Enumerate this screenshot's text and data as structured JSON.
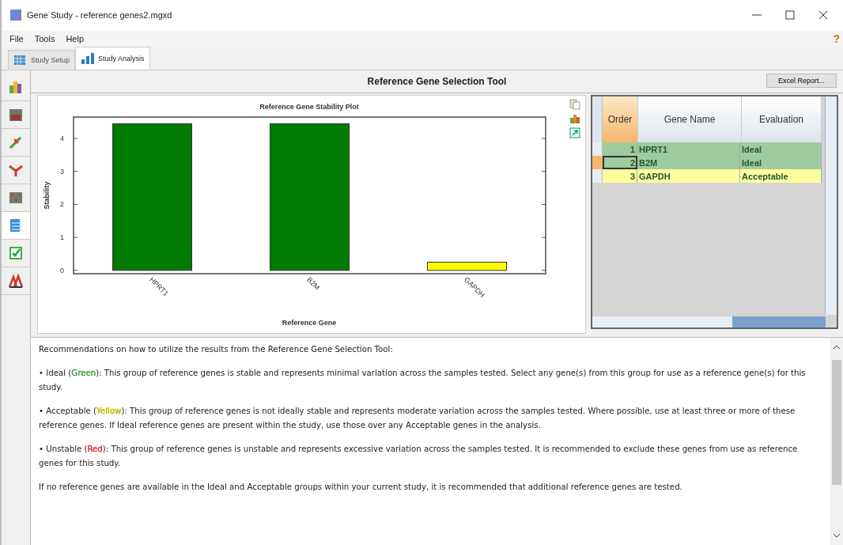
{
  "window": {
    "title": "Gene Study - reference genes2.mgxd"
  },
  "menu": [
    "File",
    "Tools",
    "Help"
  ],
  "help_mark": "?",
  "tabs": [
    {
      "label": "Study Setup",
      "kind": "setup",
      "selected": false
    },
    {
      "label": "Study Analysis",
      "kind": "analysis",
      "selected": true
    }
  ],
  "sidebar": {
    "items": [
      {
        "kind": "bars",
        "selected": false
      },
      {
        "kind": "image",
        "selected": false
      },
      {
        "kind": "scatter",
        "selected": false
      },
      {
        "kind": "branch",
        "selected": false
      },
      {
        "kind": "grid",
        "selected": false
      },
      {
        "kind": "document",
        "selected": true
      },
      {
        "kind": "check",
        "selected": false
      },
      {
        "kind": "peaks",
        "selected": false
      }
    ]
  },
  "tool": {
    "title": "Reference Gene Selection Tool",
    "excel_button": "Excel Report..."
  },
  "chart_data": {
    "type": "bar",
    "title": "Reference Gene Stability Plot",
    "xlabel": "Reference Gene",
    "ylabel": "Stability",
    "categories": [
      "HPRT1",
      "B2M",
      "GAPDH"
    ],
    "values": [
      4.45,
      4.45,
      0.25
    ],
    "ylim": [
      -0.1,
      4.65
    ],
    "yticks": [
      0,
      1,
      2,
      3,
      4
    ]
  },
  "table": {
    "columns": [
      "Order",
      "Gene Name",
      "Evaluation"
    ],
    "rows": [
      {
        "order": "1",
        "gene": "HPRT1",
        "evaluation": "Ideal",
        "color": "#007a00",
        "selected": false
      },
      {
        "order": "2",
        "gene": "B2M",
        "evaluation": "Ideal",
        "color": "#007a00",
        "selected": true
      },
      {
        "order": "3",
        "gene": "GAPDH",
        "evaluation": "Acceptable",
        "color": "#ffff00",
        "selected": false
      }
    ]
  },
  "recommendations": [
    {
      "parts": [
        {
          "text": "Recommendations on how to utilize the results from the Reference Gene Selection Tool:"
        }
      ]
    },
    {
      "parts": [
        {
          "text": "• Ideal ("
        },
        {
          "text": "Green",
          "color": "#3aa03a"
        },
        {
          "text": "): This group of reference genes is stable and represents minimal variation across the samples tested.  Select any gene(s) from this group for use as a reference gene(s) for this study."
        }
      ]
    },
    {
      "parts": [
        {
          "text": "• Acceptable ("
        },
        {
          "text": "Yellow",
          "color": "#c8b400"
        },
        {
          "text": "): This group of reference genes is not ideally stable and represents moderate variation across the samples tested.  Where possible, use at least three or more of these reference genes.  If Ideal reference genes are present within the study, use those over any Acceptable genes in the analysis."
        }
      ]
    },
    {
      "parts": [
        {
          "text": "• Unstable ("
        },
        {
          "text": "Red",
          "color": "#e03030"
        },
        {
          "text": "): This group of reference genes is unstable and represents excessive variation across the samples tested.  It is recommended to exclude these genes from use as reference genes for this study."
        }
      ]
    },
    {
      "parts": [
        {
          "text": "If no reference genes are available in the Ideal and Acceptable groups within your current study, it is recommended that additional reference genes are tested."
        }
      ]
    }
  ]
}
